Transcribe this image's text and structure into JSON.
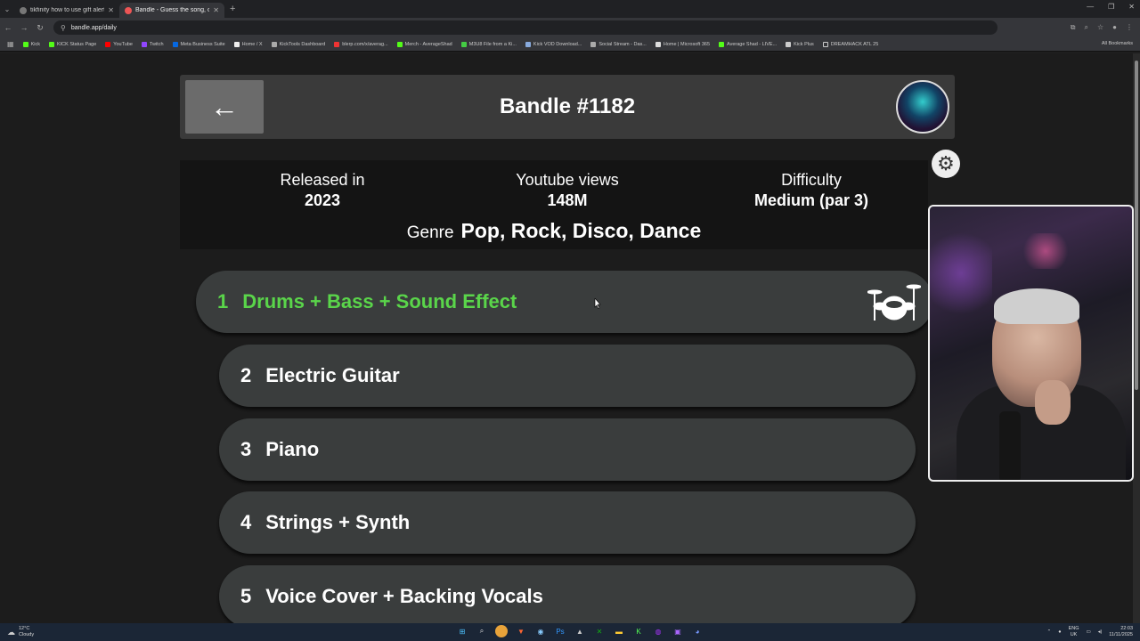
{
  "browser": {
    "tabs": [
      {
        "title": "tikfinity how to use gift alerts -",
        "active": false
      },
      {
        "title": "Bandle - Guess the song, o",
        "active": true
      }
    ],
    "url": "bandle.app/daily",
    "bookmarks": [
      "Kick",
      "KICK Status Page",
      "YouTube",
      "Twitch",
      "Meta Business Suite",
      "Home / X",
      "KickTools Dashboard",
      "blerp.com/x/averag...",
      "Merch - AverageShad",
      "M3U8 File from a Ki...",
      "Kick VOD Download...",
      "Social Stream - Das...",
      "Home | Microsoft 365",
      "Average Shad - LIVE...",
      "Kick Plus",
      "DREAMHACK ATL 25"
    ],
    "all_bookmarks": "All Bookmarks"
  },
  "game": {
    "back_icon": "←",
    "title": "Bandle #1182",
    "released_label": "Released in",
    "released_value": "2023",
    "views_label": "Youtube views",
    "views_value": "148M",
    "difficulty_label": "Difficulty",
    "difficulty_value": "Medium (par 3)",
    "genre_label": "Genre",
    "genre_value": "Pop, Rock, Disco, Dance",
    "clues": [
      {
        "num": "1",
        "label": "Drums + Bass + Sound Effect"
      },
      {
        "num": "2",
        "label": "Electric Guitar"
      },
      {
        "num": "3",
        "label": "Piano"
      },
      {
        "num": "4",
        "label": "Strings + Synth"
      },
      {
        "num": "5",
        "label": "Voice Cover + Backing Vocals"
      }
    ]
  },
  "taskbar": {
    "temp": "12°C",
    "weather": "Cloudy",
    "lang": "ENG",
    "region": "UK",
    "time": "22:03",
    "date": "11/11/2025"
  },
  "colors": {
    "accent_green": "#5ad54a",
    "clue_bg": "#3a3d3d",
    "header_bg": "#3a3a3a"
  }
}
